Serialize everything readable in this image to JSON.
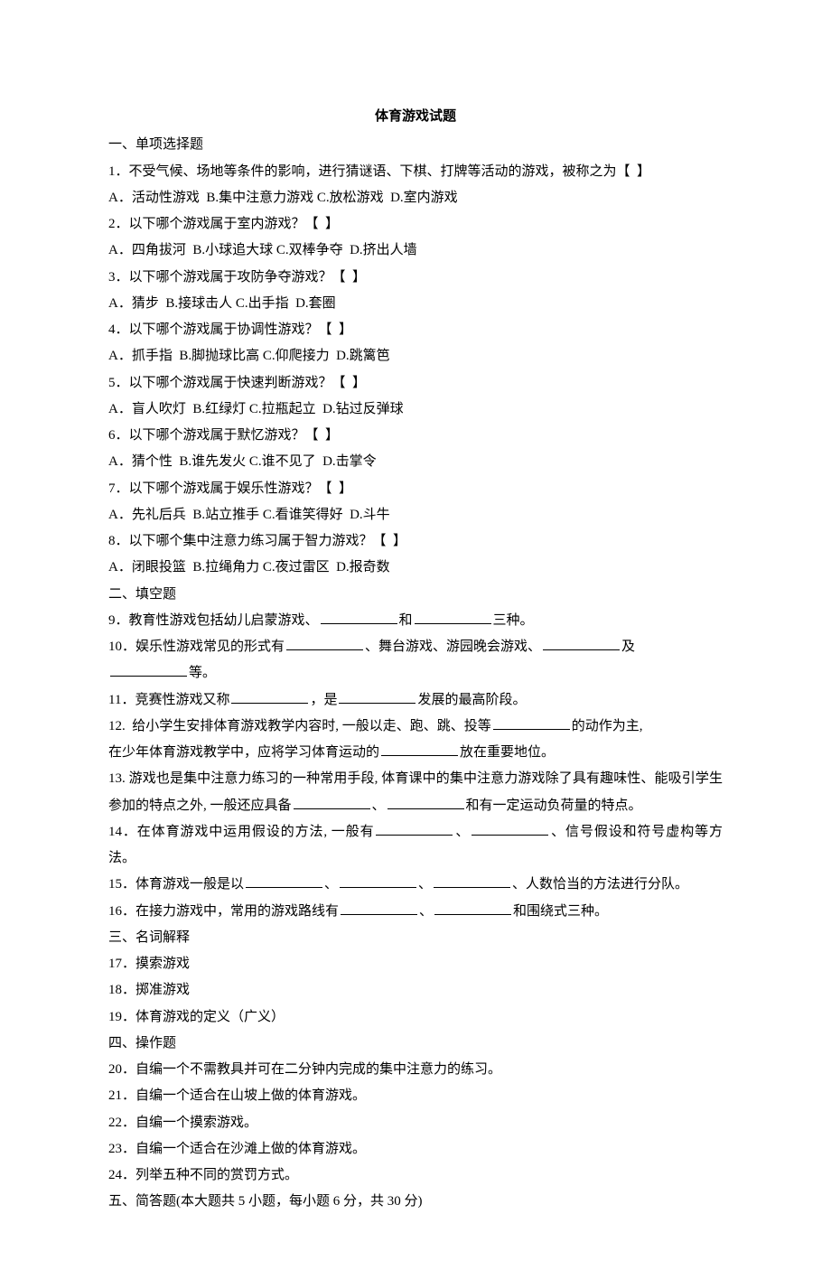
{
  "title": "体育游戏试题",
  "sections": {
    "s1_header": "一、单项选择题",
    "q1": "1．不受气候、场地等条件的影响，进行猜谜语、下棋、打牌等活动的游戏，被称之为【  】",
    "q1_opts": "A．活动性游戏  B.集中注意力游戏 C.放松游戏  D.室内游戏",
    "q2": "2．以下哪个游戏属于室内游戏？【  】",
    "q2_opts": "A．四角拔河  B.小球追大球 C.双棒争夺  D.挤出人墙",
    "q3": "3．以下哪个游戏属于攻防争夺游戏？【  】",
    "q3_opts": "A．猜步  B.接球击人 C.出手指  D.套圈",
    "q4": "4．以下哪个游戏属于协调性游戏？【  】",
    "q4_opts": "A．抓手指  B.脚抛球比高 C.仰爬接力  D.跳篱笆",
    "q5": "5．以下哪个游戏属于快速判断游戏？【  】",
    "q5_opts": "A．盲人吹灯  B.红绿灯 C.拉瓶起立  D.钻过反弹球",
    "q6": "6．以下哪个游戏属于默忆游戏？【  】",
    "q6_opts": "A．猜个性  B.谁先发火 C.谁不见了  D.击掌令",
    "q7": "7．以下哪个游戏属于娱乐性游戏？【  】",
    "q7_opts": "A．先礼后兵  B.站立推手 C.看谁笑得好  D.斗牛",
    "q8": "8．以下哪个集中注意力练习属于智力游戏？【  】",
    "q8_opts": "A．闭眼投篮  B.拉绳角力 C.夜过雷区  D.报奇数",
    "s2_header": "二、填空题",
    "q9_a": "9．教育性游戏包括幼儿启蒙游戏、",
    "q9_b": "和",
    "q9_c": "三种。",
    "q10_a": "10．娱乐性游戏常见的形式有",
    "q10_b": "、舞台游戏、游园晚会游戏、",
    "q10_c": "及",
    "q10_d": "等。",
    "q11_a": "11．竞赛性游戏又称",
    "q11_b": "，是",
    "q11_c": "发展的最高阶段。",
    "q12_a": "12.  给小学生安排体育游戏教学内容时, 一般以走、跑、跳、投等",
    "q12_b": "的动作为主,",
    "q12_c": "在少年体育游戏教学中，应将学习体育运动的",
    "q12_d": "放在重要地位。",
    "q13_a": "13. 游戏也是集中注意力练习的一种常用手段, 体育课中的集中注意力游戏除了具有趣味性、能吸引学生参加的特点之外, 一般还应具备",
    "q13_b": "、",
    "q13_c": "和有一定运动负荷量的特点。",
    "q14_a": "14．在体育游戏中运用假设的方法, 一般有",
    "q14_b": "、",
    "q14_c": "、信号假设和符号虚构等方法。",
    "q15_a": "15．体育游戏一般是以",
    "q15_b": "、",
    "q15_c": "、",
    "q15_d": "、人数恰当的方法进行分队。",
    "q16_a": "16．在接力游戏中，常用的游戏路线有",
    "q16_b": "、",
    "q16_c": "和围绕式三种。",
    "s3_header": "三、名词解释",
    "q17": "17．摸索游戏",
    "q18": "18．掷准游戏",
    "q19": "19．体育游戏的定义（广义）",
    "s4_header": "四、操作题",
    "q20": "20．自编一个不需教具并可在二分钟内完成的集中注意力的练习。",
    "q21": "21．自编一个适合在山坡上做的体育游戏。",
    "q22": "22．自编一个摸索游戏。",
    "q23": "23．自编一个适合在沙滩上做的体育游戏。",
    "q24": "24．列举五种不同的赏罚方式。",
    "s5_header": "五、简答题(本大题共 5 小题，每小题 6 分，共 30 分)"
  }
}
